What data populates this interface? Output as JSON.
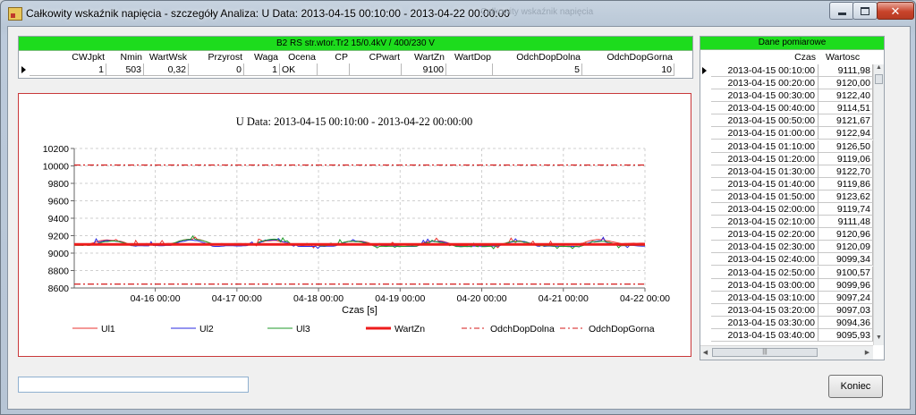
{
  "window": {
    "title": "Całkowity wskaźnik napięcia - szczegóły  Analiza: U    Data: 2013-04-15 00:10:00 - 2013-04-22 00:00:00",
    "ghost_title": "Całkowity wskaźnik napięcia",
    "close_glyph": "✕"
  },
  "info": {
    "header": "B2 RS str.wtor.Tr2 15/0.4kV / 400/230 V",
    "columns": [
      "CWJpkt",
      "Nmin",
      "WartWsk",
      "Przyrost",
      "Waga",
      "Ocena",
      "CP",
      "CPwart",
      "WartZn",
      "WartDop",
      "OdchDopDolna",
      "OdchDopGorna"
    ],
    "values": [
      "1",
      "503",
      "0,32",
      "0",
      "1",
      "OK",
      "",
      "",
      "9100",
      "",
      "5",
      "10"
    ]
  },
  "chart_data": {
    "type": "line",
    "title": "U   Data: 2013-04-15 00:10:00 - 2013-04-22 00:00:00",
    "xlabel": "Czas [s]",
    "ylabel": "",
    "x_range": [
      "2013-04-15 00:10:00",
      "2013-04-22 00:00:00"
    ],
    "xticks": [
      "04-16 00:00",
      "04-17 00:00",
      "04-18 00:00",
      "04-19 00:00",
      "04-20 00:00",
      "04-21 00:00",
      "04-22 00:00"
    ],
    "ylim": [
      8600,
      10200
    ],
    "yticks": [
      8600,
      8800,
      9000,
      9200,
      9400,
      9600,
      9800,
      10000,
      10200
    ],
    "grid": true,
    "legend_position": "bottom",
    "series": [
      {
        "name": "Ul1",
        "color": "#e8332f",
        "style": "solid",
        "base": 9115,
        "amp": 55,
        "seed": 3
      },
      {
        "name": "Ul2",
        "color": "#2a2ae0",
        "style": "solid",
        "base": 9118,
        "amp": 60,
        "seed": 7
      },
      {
        "name": "Ul3",
        "color": "#1f9a2a",
        "style": "solid",
        "base": 9108,
        "amp": 58,
        "seed": 11
      },
      {
        "name": "WartZn",
        "color": "#ee1c1c",
        "style": "thick",
        "value": 9100
      },
      {
        "name": "OdchDopDolna",
        "color": "#d41a1a",
        "style": "dashdot",
        "value": 8645
      },
      {
        "name": "OdchDopGorna",
        "color": "#d41a1a",
        "style": "dashdot",
        "value": 10010
      }
    ]
  },
  "list": {
    "header": "Dane pomiarowe",
    "col_time": "Czas",
    "col_value": "Wartosc",
    "rows": [
      [
        "2013-04-15 00:10:00",
        "9111,98"
      ],
      [
        "2013-04-15 00:20:00",
        "9120,00"
      ],
      [
        "2013-04-15 00:30:00",
        "9122,40"
      ],
      [
        "2013-04-15 00:40:00",
        "9114,51"
      ],
      [
        "2013-04-15 00:50:00",
        "9121,67"
      ],
      [
        "2013-04-15 01:00:00",
        "9122,94"
      ],
      [
        "2013-04-15 01:10:00",
        "9126,50"
      ],
      [
        "2013-04-15 01:20:00",
        "9119,06"
      ],
      [
        "2013-04-15 01:30:00",
        "9122,70"
      ],
      [
        "2013-04-15 01:40:00",
        "9119,86"
      ],
      [
        "2013-04-15 01:50:00",
        "9123,62"
      ],
      [
        "2013-04-15 02:00:00",
        "9119,74"
      ],
      [
        "2013-04-15 02:10:00",
        "9111,48"
      ],
      [
        "2013-04-15 02:20:00",
        "9120,96"
      ],
      [
        "2013-04-15 02:30:00",
        "9120,09"
      ],
      [
        "2013-04-15 02:40:00",
        "9099,34"
      ],
      [
        "2013-04-15 02:50:00",
        "9100,57"
      ],
      [
        "2013-04-15 03:00:00",
        "9099,96"
      ],
      [
        "2013-04-15 03:10:00",
        "9097,24"
      ],
      [
        "2013-04-15 03:20:00",
        "9097,03"
      ],
      [
        "2013-04-15 03:30:00",
        "9094,36"
      ],
      [
        "2013-04-15 03:40:00",
        "9095,93"
      ]
    ]
  },
  "bottom": {
    "status_value": "",
    "koniec_label": "Koniec"
  }
}
